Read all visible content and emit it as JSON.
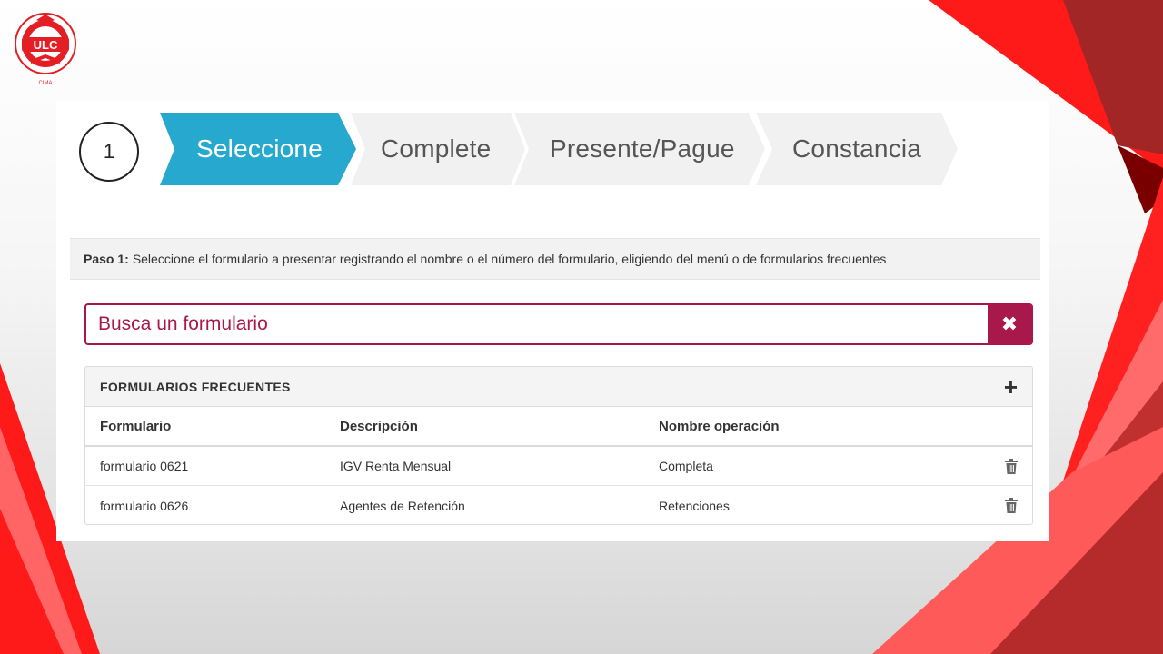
{
  "logo": {
    "initials": "ULC",
    "arc_text": "UNIVERSIDAD LATINOAMERICANA",
    "sub_text": "CIMA"
  },
  "step": {
    "number": "1"
  },
  "steps": [
    {
      "label": "Seleccione",
      "active": true
    },
    {
      "label": "Complete",
      "active": false
    },
    {
      "label": "Presente/Pague",
      "active": false
    },
    {
      "label": "Constancia",
      "active": false
    }
  ],
  "instruction": {
    "prefix": "Paso 1:",
    "text": "Seleccione el formulario a presentar registrando el nombre o el número del formulario, eligiendo del menú o de formularios frecuentes"
  },
  "search": {
    "placeholder": "Busca un formulario",
    "clear_symbol": "✖"
  },
  "frequent": {
    "title": "FORMULARIOS FRECUENTES",
    "add_symbol": "+",
    "columns": [
      "Formulario",
      "Descripción",
      "Nombre operación"
    ],
    "rows": [
      {
        "form": "formulario 0621",
        "description": "IGV Renta Mensual",
        "operation": "Completa"
      },
      {
        "form": "formulario 0626",
        "description": "Agentes de Retención",
        "operation": "Retenciones"
      }
    ]
  },
  "colors": {
    "active_step": "#27a9cf",
    "inactive_step": "#f1f1f1",
    "accent": "#a8184b",
    "brand_red": "#e31e24"
  },
  "icons": {
    "clear": "close-icon",
    "add": "plus-icon",
    "delete": "trash-icon"
  }
}
